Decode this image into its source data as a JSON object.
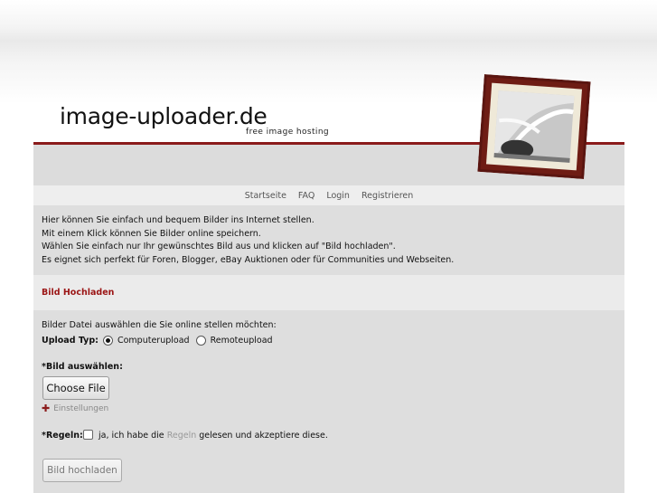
{
  "site": {
    "logo_text": "image-uploader.de",
    "tagline": "free image hosting"
  },
  "nav": {
    "items": [
      "Startseite",
      "FAQ",
      "Login",
      "Registrieren"
    ]
  },
  "intro": {
    "lines": [
      "Hier können Sie einfach und bequem Bilder ins Internet stellen.",
      "Mit einem Klick können Sie Bilder online speichern.",
      "Wählen Sie einfach nur Ihr gewünschtes Bild aus und klicken auf \"Bild hochladen\".",
      "Es eignet sich perfekt für Foren, Blogger, eBay Auktionen oder für Communities und Webseiten."
    ]
  },
  "upload": {
    "section_title": "Bild Hochladen",
    "instruction": "Bilder Datei auswählen die Sie online stellen möchten:",
    "type_label": "Upload Typ:",
    "options": [
      "Computerupload",
      "Remoteupload"
    ],
    "selected_option": "Computerupload",
    "file_label": "*Bild auswählen:",
    "choose_file_label": "Choose File",
    "settings_icon": "plus-icon",
    "settings_label": "Einstellungen",
    "rules_label": "*Regeln:",
    "rules_text_before": "ja, ich habe die",
    "rules_link": "Regeln",
    "rules_text_after": "gelesen und akzeptiere diese.",
    "rules_checked": false,
    "submit_label": "Bild hochladen"
  },
  "colors": {
    "accent": "#8b1b1b",
    "section_title": "#9b1515"
  }
}
